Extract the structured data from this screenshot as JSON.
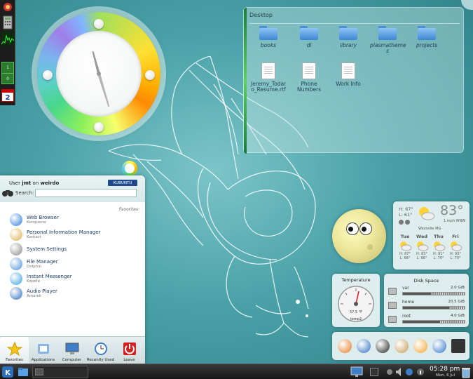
{
  "desktop_folder": {
    "title": "Desktop",
    "items": [
      {
        "label": "books",
        "type": "folder"
      },
      {
        "label": "dl",
        "type": "folder"
      },
      {
        "label": "library",
        "type": "folder"
      },
      {
        "label": "plasmatheme\ns",
        "type": "folder"
      },
      {
        "label": "projects",
        "type": "folder"
      },
      {
        "label": "Jeremy_Todar\no_Resume.rtf",
        "type": "document"
      },
      {
        "label": "Phone\nNumbers",
        "type": "document"
      },
      {
        "label": "Work Info",
        "type": "document"
      }
    ]
  },
  "menu": {
    "user_prefix": "User",
    "user": "jmt",
    "host_prefix": "on",
    "host": "weirdo",
    "brand": "KUBUNTU",
    "search_label": "Search:",
    "search_value": "",
    "favorites_heading": "Favorites",
    "favorites": [
      {
        "name": "Web Browser",
        "app": "Konqueror",
        "icon": "globe-icon",
        "color": "#2a7bd6"
      },
      {
        "name": "Personal Information Manager",
        "app": "Kontact",
        "icon": "pim-icon",
        "color": "#e0b050"
      },
      {
        "name": "System Settings",
        "app": "",
        "icon": "settings-icon",
        "color": "#8a8a8a"
      },
      {
        "name": "File Manager",
        "app": "Dolphin",
        "icon": "folder-icon",
        "color": "#4a90d9"
      },
      {
        "name": "Instant Messenger",
        "app": "Kopete",
        "icon": "messenger-icon",
        "color": "#3aa3d8"
      },
      {
        "name": "Audio Player",
        "app": "Amarok",
        "icon": "audio-icon",
        "color": "#2c6fbf"
      }
    ],
    "tabs": [
      {
        "label": "Favorites",
        "icon": "star-icon"
      },
      {
        "label": "Applications",
        "icon": "applications-icon"
      },
      {
        "label": "Computer",
        "icon": "computer-icon"
      },
      {
        "label": "Recently Used",
        "icon": "recent-icon"
      },
      {
        "label": "Leave",
        "icon": "leave-icon"
      }
    ]
  },
  "weather": {
    "high": "H: 67°",
    "low": "L: 61°",
    "temp": "83°",
    "wind": "1 mph WNW",
    "location": "Westville MG",
    "days": [
      {
        "day": "Tue",
        "high": "H: 87°",
        "low": "L: 66°"
      },
      {
        "day": "Wed",
        "high": "H: 83°",
        "low": "L: 66°"
      },
      {
        "day": "Thu",
        "high": "H: 91°",
        "low": "L: 70°"
      },
      {
        "day": "Fri",
        "high": "H: 93°",
        "low": "L: 70°"
      }
    ]
  },
  "temperature": {
    "title": "Temperature",
    "reading": "57.5 °F",
    "sensor": "temp2"
  },
  "disk_space": {
    "title": "Disk Space",
    "entries": [
      {
        "name": "var",
        "size": "2.0 GiB",
        "fill": 0.45
      },
      {
        "name": "home",
        "size": "20.5 GiB",
        "fill": 0.75
      },
      {
        "name": "root",
        "size": "4.0 GiB",
        "fill": 0.6
      }
    ]
  },
  "quicklaunch": [
    {
      "name": "firefox",
      "color": "#e8761e"
    },
    {
      "name": "thunderbird",
      "color": "#2f6fbf"
    },
    {
      "name": "inkscape",
      "color": "#222222"
    },
    {
      "name": "gimp",
      "color": "#c39b55"
    },
    {
      "name": "fish",
      "color": "#f2a12a"
    },
    {
      "name": "konqueror",
      "color": "#2e74c8"
    },
    {
      "name": "terminal",
      "color": "#333333"
    }
  ],
  "taskbar": {
    "window_label": "",
    "time": "05:28 pm",
    "date": "Mon, 6 Jul"
  },
  "clock": {
    "hour_angle": 345,
    "minute_angle": 163
  }
}
